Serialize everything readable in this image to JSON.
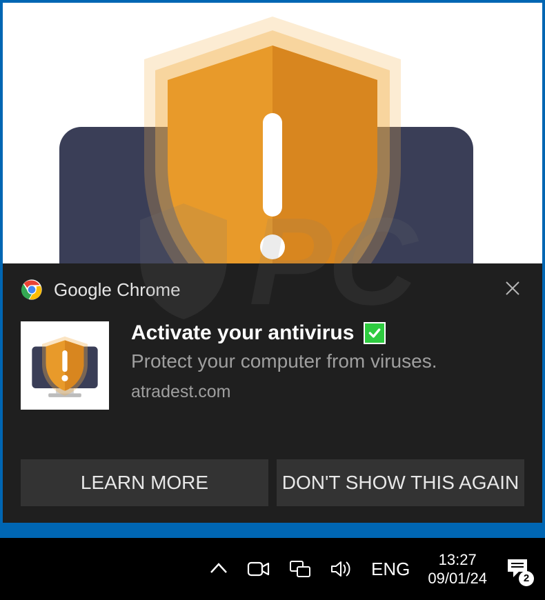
{
  "notification": {
    "app_name": "Google Chrome",
    "title": "Activate your antivirus",
    "subtitle": "Protect your computer from viruses.",
    "domain": "atradest.com",
    "icon_semantic": "shield-exclaim-monitor-icon",
    "check_icon": "checkmark-box-icon",
    "buttons": {
      "learn_more": "LEARN MORE",
      "dont_show": "DON'T SHOW THIS AGAIN"
    }
  },
  "taskbar": {
    "language": "ENG",
    "time": "13:27",
    "date": "09/01/24",
    "action_center_count": "2"
  },
  "colors": {
    "shield_orange": "#e89a2a",
    "shield_orange_light": "#f3b34f",
    "monitor_dark": "#3a3e57",
    "notif_bg": "#1f1f1f",
    "btn_bg": "#333333",
    "accent_blue": "#0066b3",
    "check_green": "#2ecc40"
  }
}
